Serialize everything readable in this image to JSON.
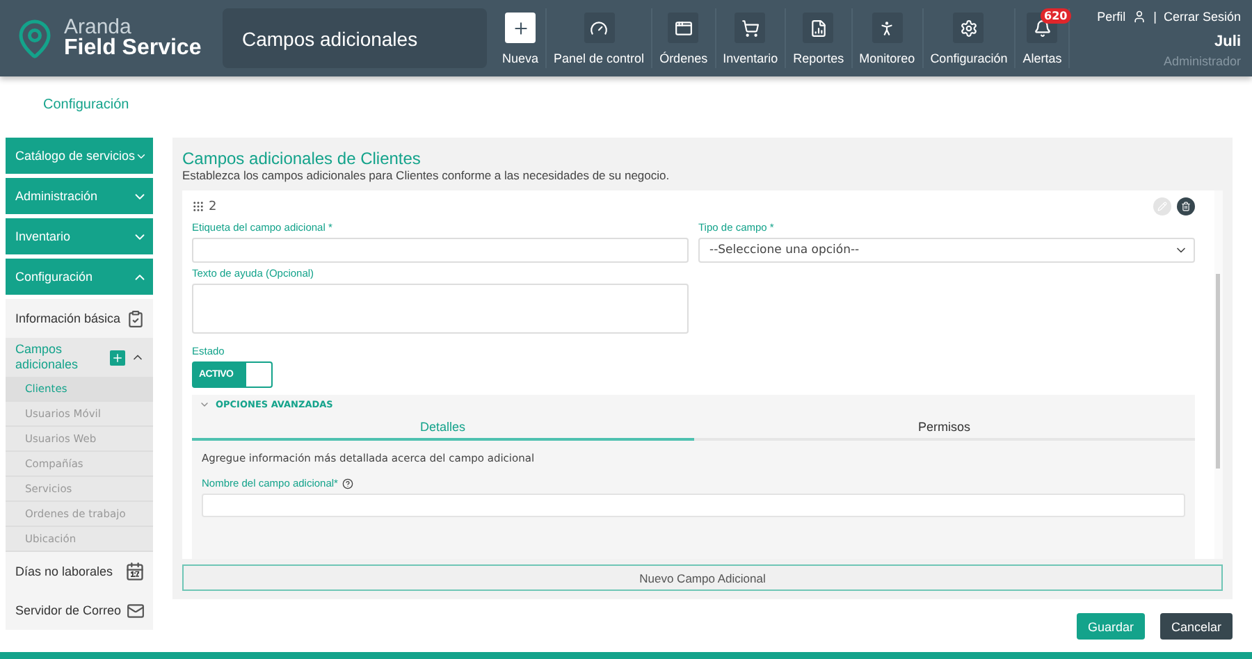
{
  "header": {
    "logo": {
      "line1": "Aranda",
      "line2": "Field Service"
    },
    "page_title": "Campos adicionales",
    "nav": [
      {
        "kind": "new",
        "label": "Nueva"
      },
      {
        "kind": "dashboard",
        "label": "Panel de control"
      },
      {
        "kind": "orders",
        "label": "Órdenes"
      },
      {
        "kind": "inventory",
        "label": "Inventario"
      },
      {
        "kind": "reports",
        "label": "Reportes"
      },
      {
        "kind": "monitor",
        "label": "Monitoreo"
      },
      {
        "kind": "settings",
        "label": "Configuración"
      },
      {
        "kind": "alerts",
        "label": "Alertas",
        "badge": "620"
      }
    ],
    "user": {
      "profile": "Perfil",
      "separator": "|",
      "logout": "Cerrar Sesión",
      "name": "Juli",
      "role": "Administrador"
    }
  },
  "breadcrumb": "Configuración",
  "sidebar": [
    {
      "label": "Catálogo de servicios",
      "expanded": false
    },
    {
      "label": "Administración",
      "expanded": false
    },
    {
      "label": "Inventario",
      "expanded": false
    },
    {
      "label": "Configuración",
      "expanded": true,
      "items": [
        {
          "kind": "info",
          "label": "Información básica"
        },
        {
          "kind": "group",
          "label": "Campos adicionales",
          "expanded": true,
          "children": [
            {
              "label": "Clientes",
              "selected": true
            },
            {
              "label": "Usuarios Móvil",
              "selected": false
            },
            {
              "label": "Usuarios Web",
              "selected": false
            },
            {
              "label": "Compañías",
              "selected": false
            },
            {
              "label": "Servicios",
              "selected": false
            },
            {
              "label": "Ordenes de trabajo",
              "selected": false
            },
            {
              "label": "Ubicación",
              "selected": false
            }
          ]
        },
        {
          "kind": "calendar",
          "label": "Días no laborales",
          "calendar_day": "17"
        },
        {
          "kind": "mail",
          "label": "Servidor de Correo"
        }
      ]
    }
  ],
  "content": {
    "title": "Campos adicionales de Clientes",
    "subtitle": "Establezca los campos adicionales para Clientes conforme a las necesidades de su negocio.",
    "field": {
      "number": "2",
      "label_field": "Etiqueta del campo adicional *",
      "type_field": "Tipo de campo *",
      "type_value": "--Seleccione una opción--",
      "help_field": "Texto de ayuda (Opcional)",
      "status": {
        "label": "Estado",
        "on": true,
        "text": "ACTIVO"
      },
      "advanced": {
        "label": "OPCIONES AVANZADAS",
        "expanded": true,
        "tabs": [
          {
            "label": "Detalles",
            "selected": true
          },
          {
            "label": "Permisos",
            "selected": false
          }
        ],
        "description": "Agregue información más detallada acerca del campo adicional",
        "name_field": "Nombre del campo adicional*"
      }
    },
    "new_button": "Nuevo Campo Adicional"
  },
  "actions": [
    {
      "kind": "primary",
      "label": "Guardar"
    },
    {
      "kind": "secondary",
      "label": "Cancelar"
    }
  ]
}
